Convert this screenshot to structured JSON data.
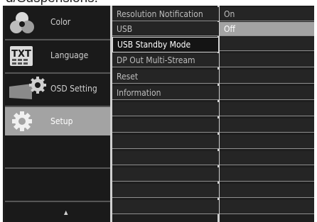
{
  "caption": "d/Suspensions.",
  "main_menu": [
    {
      "label": "Color",
      "icon": "color-wheel-icon",
      "selected": false
    },
    {
      "label": "Language",
      "icon": "txt-keyboard-icon",
      "selected": false
    },
    {
      "label": "OSD Setting",
      "icon": "osd-settings-icon",
      "selected": false
    },
    {
      "label": "Setup",
      "icon": "gear-icon",
      "selected": true
    }
  ],
  "scroll_up_glyph": "▲",
  "submenu": [
    {
      "label": "Resolution Notification",
      "selected": false
    },
    {
      "label": "USB",
      "selected": false
    },
    {
      "label": "USB Standby Mode",
      "selected": true
    },
    {
      "label": "DP Out Multi-Stream",
      "selected": false
    },
    {
      "label": "Reset",
      "selected": false
    },
    {
      "label": "Information",
      "selected": false
    }
  ],
  "options": [
    {
      "label": "On",
      "selected": false
    },
    {
      "label": "Off",
      "selected": true
    }
  ],
  "colors": {
    "background": "#1e1e1e",
    "highlight": "#a3a3a3",
    "row_border": "#8f8f8f"
  }
}
